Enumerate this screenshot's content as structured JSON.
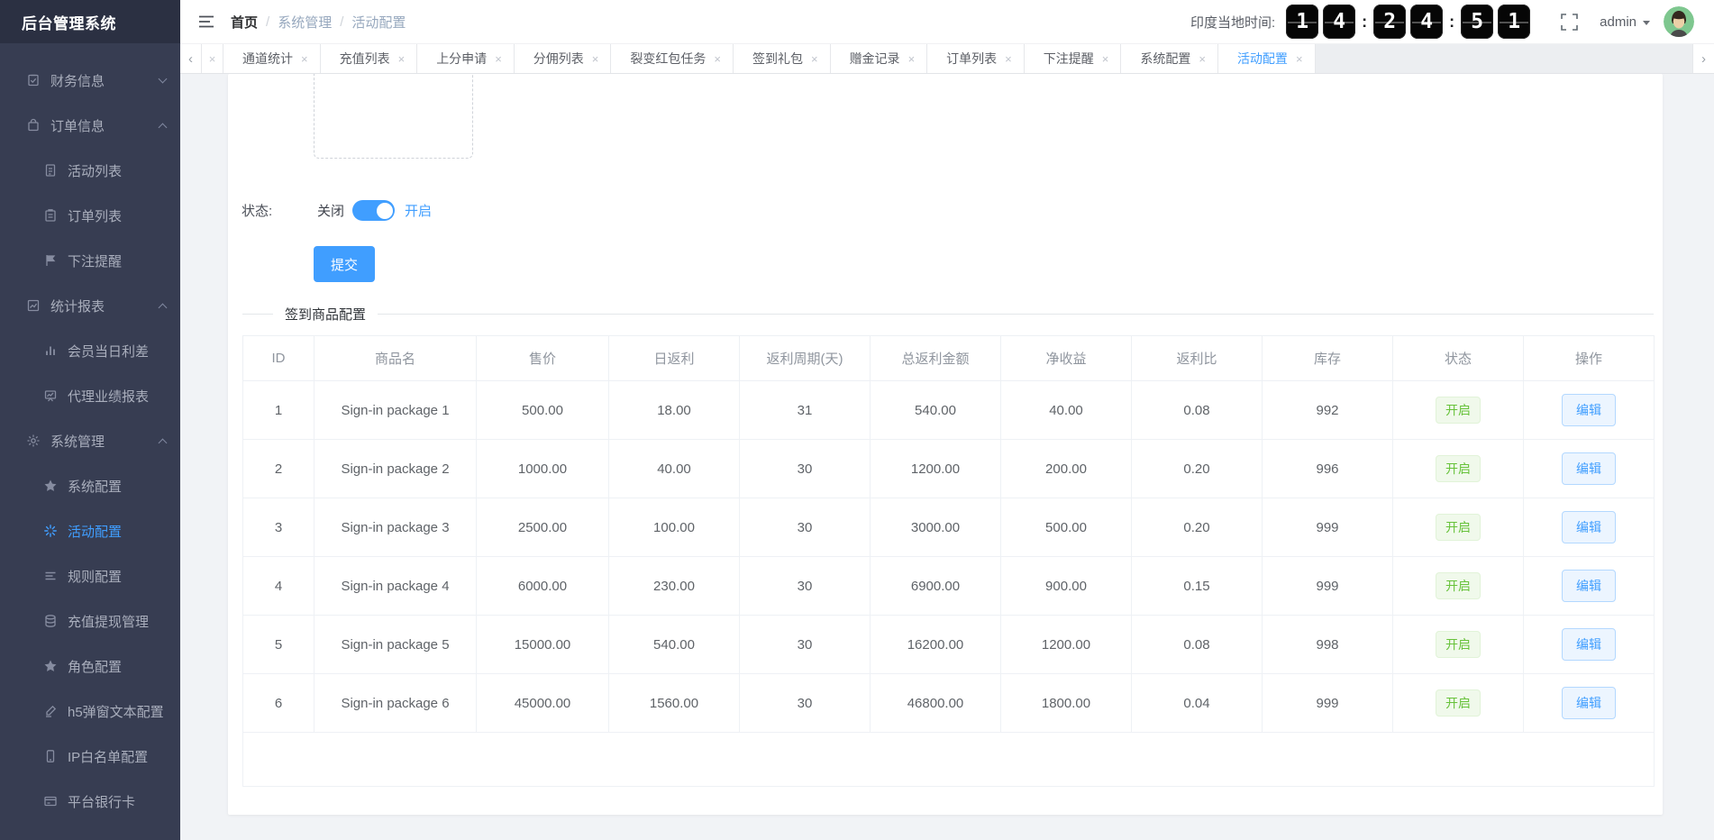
{
  "app": {
    "logo": "后台管理系统"
  },
  "colors": {
    "accent": "#409eff",
    "success": "#67c23a",
    "sidebar_bg": "#373d52",
    "logo_bg": "#2b3042",
    "content_bg": "#f1f3f6"
  },
  "glyphs": {
    "tab_close": "×",
    "scroll_left": "‹",
    "scroll_right": "›",
    "breadcrumb_sep": "/",
    "colon": ":"
  },
  "header": {
    "breadcrumb": [
      "首页",
      "系统管理",
      "活动配置"
    ],
    "clock_label": "印度当地时间:",
    "clock_digits": [
      "1",
      "4",
      "2",
      "4",
      "5",
      "1"
    ],
    "user": "admin"
  },
  "tabs": {
    "items": [
      {
        "label": "通道统计",
        "active": false
      },
      {
        "label": "充值列表",
        "active": false
      },
      {
        "label": "上分申请",
        "active": false
      },
      {
        "label": "分佣列表",
        "active": false
      },
      {
        "label": "裂变红包任务",
        "active": false
      },
      {
        "label": "签到礼包",
        "active": false
      },
      {
        "label": "赠金记录",
        "active": false
      },
      {
        "label": "订单列表",
        "active": false
      },
      {
        "label": "下注提醒",
        "active": false
      },
      {
        "label": "系统配置",
        "active": false
      },
      {
        "label": "活动配置",
        "active": true
      }
    ]
  },
  "sidebar": {
    "items": [
      {
        "label": "财务信息",
        "icon": "clipboard-check-icon",
        "type": "group",
        "expanded": false,
        "active": false
      },
      {
        "label": "订单信息",
        "icon": "bag-icon",
        "type": "group",
        "expanded": true,
        "active": false
      },
      {
        "label": "活动列表",
        "icon": "doc-lines-icon",
        "type": "sub",
        "active": false
      },
      {
        "label": "订单列表",
        "icon": "clipboard-list-icon",
        "type": "sub",
        "active": false
      },
      {
        "label": "下注提醒",
        "icon": "flag-icon",
        "type": "sub",
        "active": false
      },
      {
        "label": "统计报表",
        "icon": "chart-line-icon",
        "type": "group",
        "expanded": true,
        "active": false
      },
      {
        "label": "会员当日利差",
        "icon": "bar-chart-icon",
        "type": "sub",
        "active": false
      },
      {
        "label": "代理业绩报表",
        "icon": "presentation-chart-icon",
        "type": "sub",
        "active": false
      },
      {
        "label": "系统管理",
        "icon": "gear-icon",
        "type": "group",
        "expanded": true,
        "active": false
      },
      {
        "label": "系统配置",
        "icon": "star-icon",
        "type": "sub",
        "active": false
      },
      {
        "label": "活动配置",
        "icon": "burst-icon",
        "type": "sub",
        "active": true
      },
      {
        "label": "规则配置",
        "icon": "rules-list-icon",
        "type": "sub",
        "active": false
      },
      {
        "label": "充值提现管理",
        "icon": "database-icon",
        "type": "sub",
        "active": false
      },
      {
        "label": "角色配置",
        "icon": "star-icon",
        "type": "sub",
        "active": false
      },
      {
        "label": "h5弹窗文本配置",
        "icon": "pencil-icon",
        "type": "sub",
        "active": false
      },
      {
        "label": "IP白名单配置",
        "icon": "mobile-icon",
        "type": "sub",
        "active": false
      },
      {
        "label": "平台银行卡",
        "icon": "bank-card-icon",
        "type": "sub",
        "active": false
      }
    ]
  },
  "form": {
    "status_label": "状态:",
    "toggle_off": "关闭",
    "toggle_on": "开启",
    "toggle_state": "on",
    "submit_label": "提交"
  },
  "section": {
    "title": "签到商品配置"
  },
  "table": {
    "columns": [
      "ID",
      "商品名",
      "售价",
      "日返利",
      "返利周期(天)",
      "总返利金额",
      "净收益",
      "返利比",
      "库存",
      "状态",
      "操作"
    ],
    "status_on_label": "开启",
    "edit_label": "编辑",
    "rows": [
      {
        "id": "1",
        "name": "Sign-in package 1",
        "price": "500.00",
        "daily": "18.00",
        "cycle": "31",
        "total": "540.00",
        "net": "40.00",
        "ratio": "0.08",
        "stock": "992",
        "status": "on"
      },
      {
        "id": "2",
        "name": "Sign-in package 2",
        "price": "1000.00",
        "daily": "40.00",
        "cycle": "30",
        "total": "1200.00",
        "net": "200.00",
        "ratio": "0.20",
        "stock": "996",
        "status": "on"
      },
      {
        "id": "3",
        "name": "Sign-in package 3",
        "price": "2500.00",
        "daily": "100.00",
        "cycle": "30",
        "total": "3000.00",
        "net": "500.00",
        "ratio": "0.20",
        "stock": "999",
        "status": "on"
      },
      {
        "id": "4",
        "name": "Sign-in package 4",
        "price": "6000.00",
        "daily": "230.00",
        "cycle": "30",
        "total": "6900.00",
        "net": "900.00",
        "ratio": "0.15",
        "stock": "999",
        "status": "on"
      },
      {
        "id": "5",
        "name": "Sign-in package 5",
        "price": "15000.00",
        "daily": "540.00",
        "cycle": "30",
        "total": "16200.00",
        "net": "1200.00",
        "ratio": "0.08",
        "stock": "998",
        "status": "on"
      },
      {
        "id": "6",
        "name": "Sign-in package 6",
        "price": "45000.00",
        "daily": "1560.00",
        "cycle": "30",
        "total": "46800.00",
        "net": "1800.00",
        "ratio": "0.04",
        "stock": "999",
        "status": "on"
      }
    ]
  }
}
